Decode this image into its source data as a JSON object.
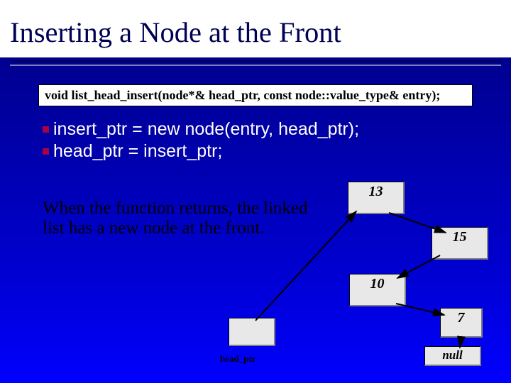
{
  "title": "Inserting a Node at the Front",
  "signature": "void list_head_insert(node*& head_ptr, const node::value_type& entry);",
  "code": {
    "line1": "insert_ptr = new node(entry, head_ptr);",
    "line2": "head_ptr = insert_ptr;"
  },
  "explain": "When the function returns, the linked list has a new node at the front.",
  "headptr_label": "head_ptr",
  "nodes": {
    "v13": "13",
    "v15": "15",
    "v10": "10",
    "v7": "7",
    "vnull": "null"
  }
}
